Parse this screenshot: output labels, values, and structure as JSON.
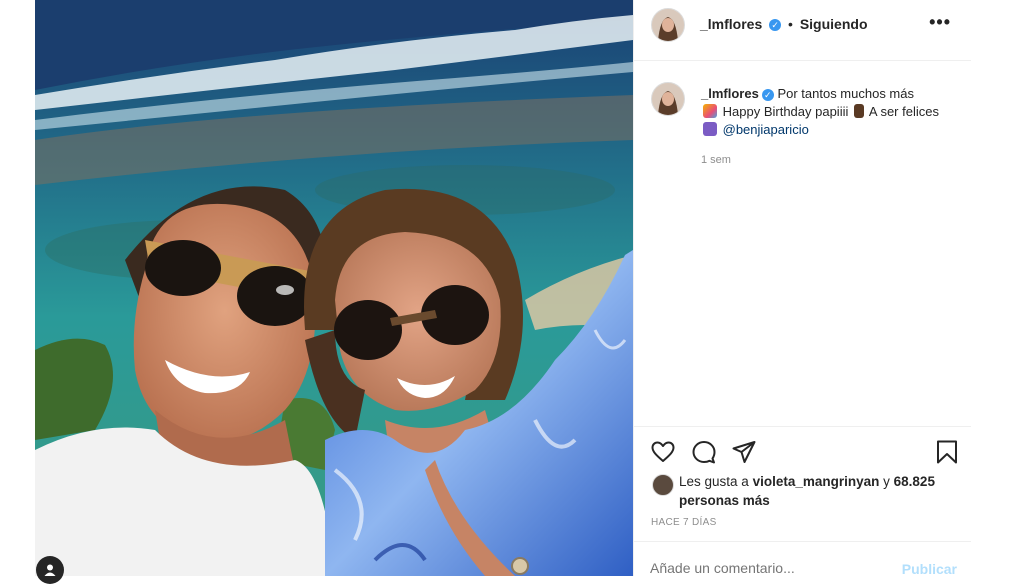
{
  "header": {
    "username": "_lmflores",
    "separator": "•",
    "follow_status": "Siguiendo",
    "more_label": "•••"
  },
  "caption": {
    "username": "_lmflores",
    "text_part1": "Por tantos muchos más",
    "text_part2": "Happy Birthday papiiii",
    "text_part3": "A ser felices",
    "mention": "@benjiaparicio",
    "time": "1 sem"
  },
  "likes": {
    "prefix": "Les gusta a",
    "user": "violeta_mangrinyan",
    "conj": "y",
    "count_text": "68.825 personas más"
  },
  "posted_ago": "HACE 7 DÍAS",
  "comment": {
    "placeholder": "Añade un comentario...",
    "publish_label": "Publicar"
  },
  "colors": {
    "verified": "#3897f0",
    "mention": "#00376b",
    "publish_disabled": "#b2dffc",
    "muted": "#8e8e8e"
  },
  "icons": {
    "verified": "verified-badge-icon",
    "like": "heart-icon",
    "comment": "comment-bubble-icon",
    "share": "paper-plane-icon",
    "save": "bookmark-icon",
    "user_tag": "user-tag-icon"
  }
}
